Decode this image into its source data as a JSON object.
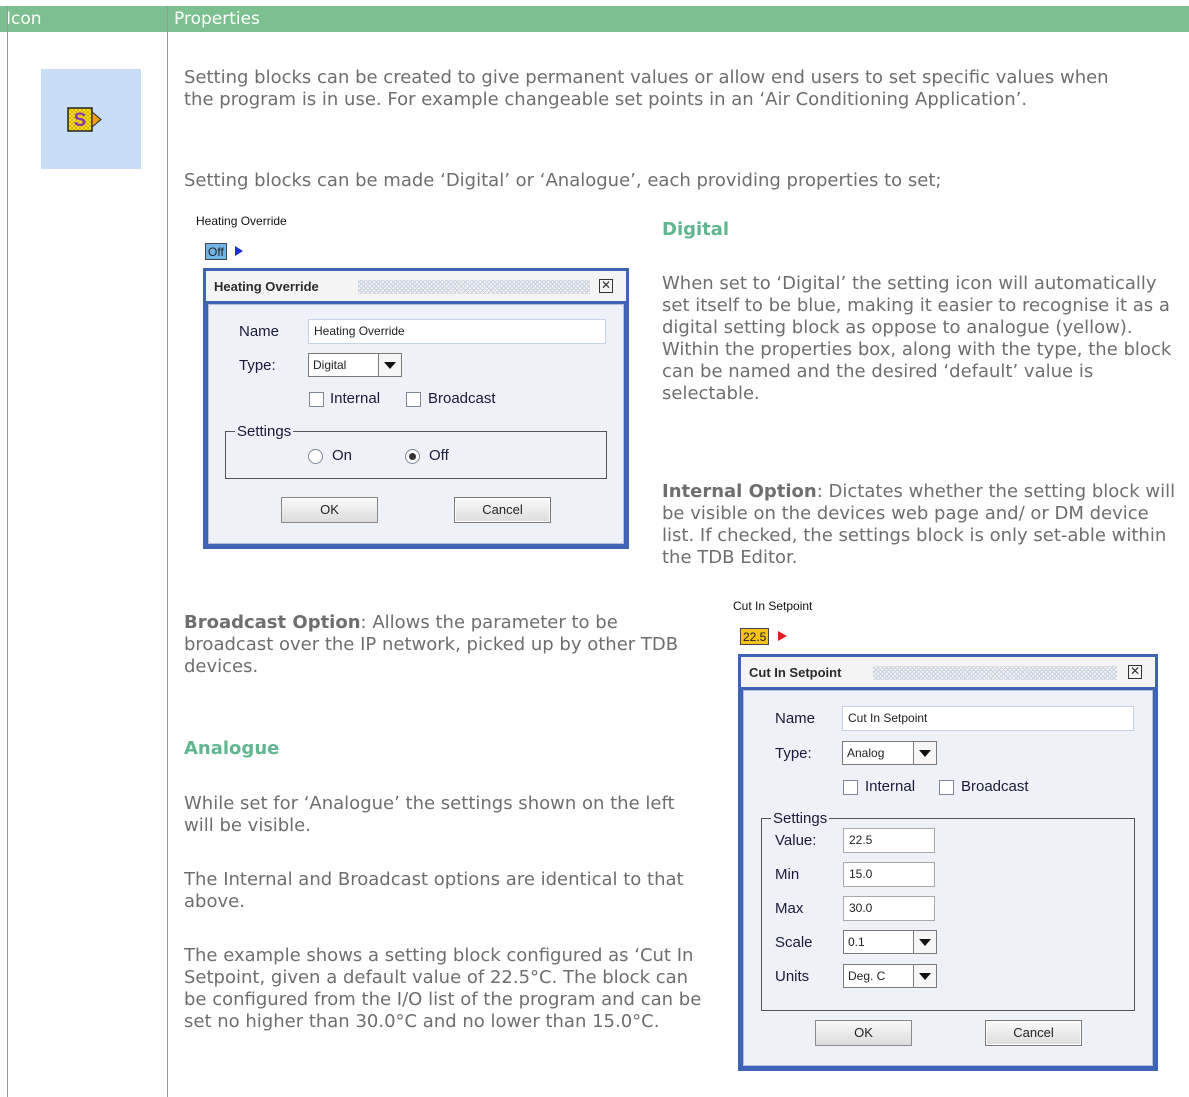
{
  "table": {
    "col_icon": "Icon",
    "col_properties": "Properties"
  },
  "icon": {
    "name": "setting-block-icon",
    "letter": "S"
  },
  "intro": {
    "p1": "Setting blocks can be created to give permanent values or allow end users to set specific values when the program is in use. For example changeable set points in an ‘Air Conditioning Application’.",
    "p2": "Setting blocks can be made ‘Digital’ or ‘Analogue’, each providing properties to set;"
  },
  "digital_section": {
    "heading": "Digital",
    "p1": "When set to ‘Digital’ the setting icon will automatically set itself to be blue, making it easier to recognise it as a digital setting block as oppose to analogue (yellow). Within the properties box, along with the type, the block can be named and the desired ‘default’ value is selectable.",
    "internal_label": "Internal Option",
    "internal_text": ": Dictates whether the setting block will be visible on the devices web page and/ or DM device list. If checked, the settings block is only set-able within the TDB Editor."
  },
  "broadcast": {
    "label": "Broadcast Option",
    "text": ": Allows the parameter to be broadcast over the IP network, picked up by other TDB devices."
  },
  "analogue_section": {
    "heading": "Analogue",
    "p1": "While set for ‘Analogue’ the settings shown on the left will be visible.",
    "p2": "The Internal and Broadcast options are identical to that above.",
    "p3": "The example shows a setting block configured as ‘Cut In Setpoint, given a default value of 22.5°C. The block can be configured from the I/O list of the program and can be set no higher than 30.0°C and no lower than 15.0°C."
  },
  "digital_dialog": {
    "caption": "Heating Override",
    "tag_value": "Off",
    "tag_color": "#6fb6e6",
    "title": "Heating Override",
    "name_label": "Name",
    "name_value": "Heating Override",
    "type_label": "Type:",
    "type_value": "Digital",
    "internal": "Internal",
    "broadcast": "Broadcast",
    "settings_label": "Settings",
    "radio_on": "On",
    "radio_off": "Off",
    "selected": "Off",
    "ok": "OK",
    "cancel": "Cancel"
  },
  "analog_dialog": {
    "caption": "Cut In Setpoint",
    "tag_value": "22.5",
    "tag_color": "#f5c21b",
    "title": "Cut In Setpoint",
    "name_label": "Name",
    "name_value": "Cut In Setpoint",
    "type_label": "Type:",
    "type_value": "Analog",
    "internal": "Internal",
    "broadcast": "Broadcast",
    "settings_label": "Settings",
    "value_label": "Value:",
    "value": "22.5",
    "min_label": "Min",
    "min": "15.0",
    "max_label": "Max",
    "max": "30.0",
    "scale_label": "Scale",
    "scale": "0.1",
    "units_label": "Units",
    "units": "Deg. C",
    "ok": "OK",
    "cancel": "Cancel"
  }
}
